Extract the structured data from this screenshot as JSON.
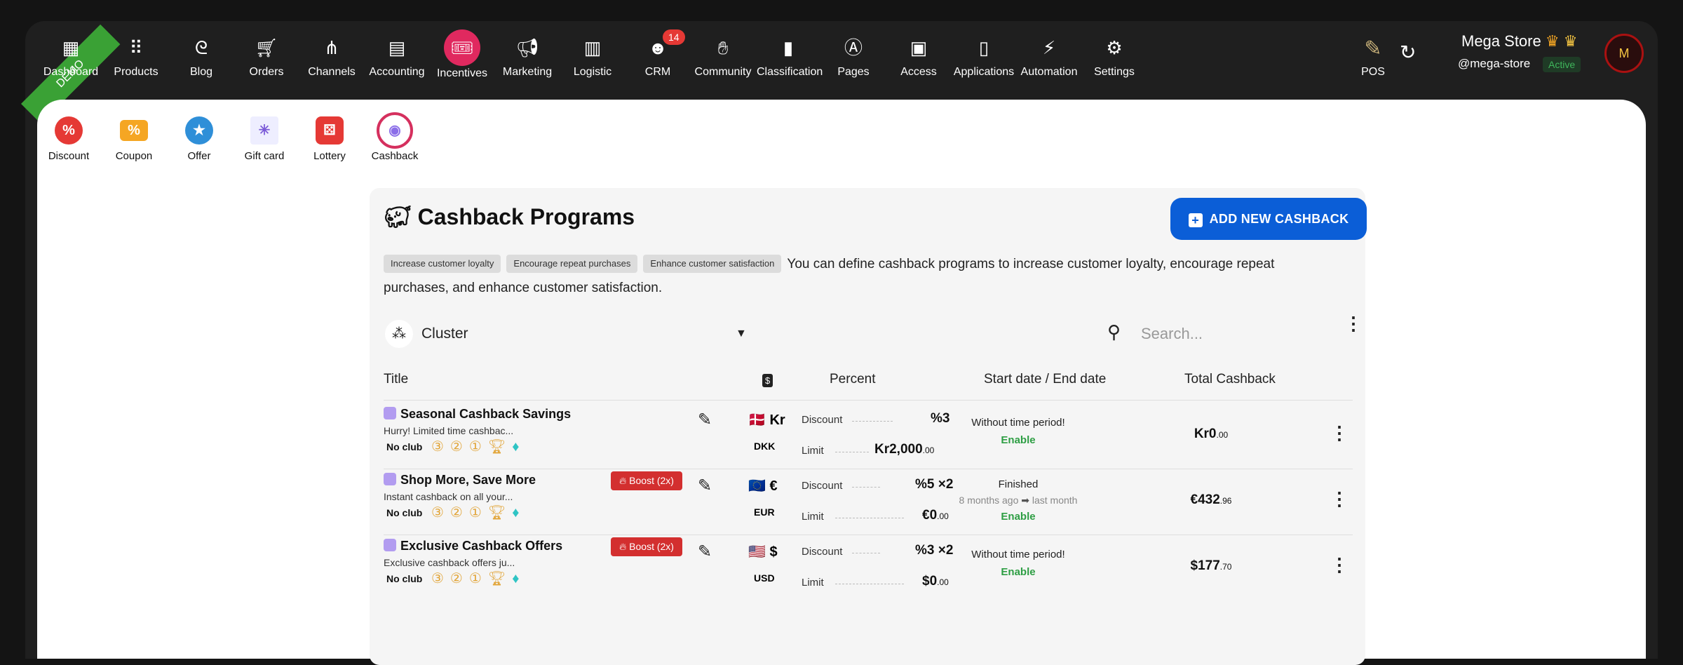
{
  "topnav": {
    "items": [
      {
        "label": "Dashboard",
        "icon": "dashboard-icon"
      },
      {
        "label": "Products",
        "icon": "grid-icon"
      },
      {
        "label": "Blog",
        "icon": "blog-icon"
      },
      {
        "label": "Orders",
        "icon": "cart-icon"
      },
      {
        "label": "Channels",
        "icon": "channels-icon"
      },
      {
        "label": "Accounting",
        "icon": "register-icon"
      },
      {
        "label": "Incentives",
        "icon": "ticket-icon"
      },
      {
        "label": "Marketing",
        "icon": "megaphone-icon"
      },
      {
        "label": "Logistic",
        "icon": "warehouse-icon"
      },
      {
        "label": "CRM",
        "icon": "face-icon",
        "badge": "14"
      },
      {
        "label": "Community",
        "icon": "hands-icon"
      },
      {
        "label": "Classification",
        "icon": "book-icon"
      },
      {
        "label": "Pages",
        "icon": "pages-icon"
      },
      {
        "label": "Access",
        "icon": "id-badge-icon"
      },
      {
        "label": "Applications",
        "icon": "phone-icon"
      },
      {
        "label": "Automation",
        "icon": "bolt-icon"
      },
      {
        "label": "Settings",
        "icon": "gear-icon"
      }
    ],
    "demo_label": "DEMO",
    "pos_label": "POS",
    "store_name": "Mega Store",
    "store_handle": "@mega-store",
    "store_status": "Active",
    "avatar_text": "M"
  },
  "subnav": {
    "items": [
      {
        "label": "Discount",
        "icon": "discount-icon",
        "color": "#e53935"
      },
      {
        "label": "Coupon",
        "icon": "coupon-icon",
        "color": "#f5a623"
      },
      {
        "label": "Offer",
        "icon": "offer-icon",
        "color": "#2f8fd8"
      },
      {
        "label": "Gift card",
        "icon": "gift-card-icon",
        "color": "#7b5bd8"
      },
      {
        "label": "Lottery",
        "icon": "dice-icon",
        "color": "#e53935"
      },
      {
        "label": "Cashback",
        "icon": "cashback-icon",
        "color": "#8b6ee8"
      }
    ]
  },
  "panel": {
    "title": "Cashback Programs",
    "add_button": "ADD NEW CASHBACK",
    "tags": [
      "Increase customer loyalty",
      "Encourage repeat purchases",
      "Enhance customer satisfaction"
    ],
    "description": "You can define cashback programs to increase customer loyalty, encourage repeat purchases, and enhance customer satisfaction.",
    "cluster_label": "Cluster",
    "search_placeholder": "Search..."
  },
  "table": {
    "headers": {
      "title": "Title",
      "currency": "$",
      "percent": "Percent",
      "dates": "Start date / End date",
      "total": "Total Cashback"
    },
    "rows": [
      {
        "title": "Seasonal Cashback Savings",
        "subtitle": "Hurry! Limited time cashbac...",
        "club": "No club",
        "boost": "",
        "flag": "🇩🇰",
        "symbol": "Kr",
        "code": "DKK",
        "discount_label": "Discount",
        "discount_value": "%3",
        "limit_label": "Limit",
        "limit_value": "Kr2,000",
        "limit_cents": ".00",
        "date_main": "Without time period!",
        "date_from": "",
        "date_to": "",
        "status": "Enable",
        "total": "Kr0",
        "total_cents": ".00"
      },
      {
        "title": "Shop More, Save More",
        "subtitle": "Instant cashback on all your...",
        "club": "No club",
        "boost": "Boost (2x)",
        "flag": "🇪🇺",
        "symbol": "€",
        "code": "EUR",
        "discount_label": "Discount",
        "discount_value": "%5 ×2",
        "limit_label": "Limit",
        "limit_value": "€0",
        "limit_cents": ".00",
        "date_main": "Finished",
        "date_from": "8 months ago",
        "date_to": "last month",
        "status": "Enable",
        "total": "€432",
        "total_cents": ".96"
      },
      {
        "title": "Exclusive Cashback Offers",
        "subtitle": "Exclusive cashback offers ju...",
        "club": "No club",
        "boost": "Boost (2x)",
        "flag": "🇺🇸",
        "symbol": "$",
        "code": "USD",
        "discount_label": "Discount",
        "discount_value": "%3 ×2",
        "limit_label": "Limit",
        "limit_value": "$0",
        "limit_cents": ".00",
        "date_main": "Without time period!",
        "date_from": "",
        "date_to": "",
        "status": "Enable",
        "total": "$177",
        "total_cents": ".70"
      }
    ]
  }
}
